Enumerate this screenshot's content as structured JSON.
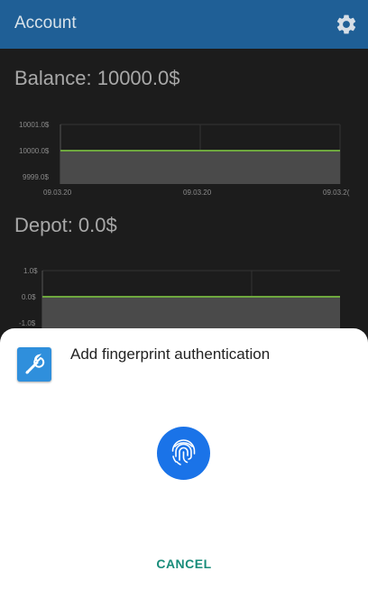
{
  "app_bar": {
    "title": "Account",
    "settings_icon": "gear-icon"
  },
  "balance": {
    "title": "Balance: 10000.0$",
    "chart_data": {
      "type": "area",
      "y_ticks": [
        "10001.0$",
        "10000.0$",
        "9999.0$"
      ],
      "x_ticks": [
        "09.03.20",
        "09.03.20",
        "09.03.2("
      ],
      "ylim": [
        9999.0,
        10001.0
      ],
      "series": [
        {
          "values": [
            10000.0,
            10000.0
          ]
        }
      ],
      "line_color": "#6ea83e",
      "fill_color": "#4a4a4a",
      "grid": true
    }
  },
  "depot": {
    "title": "Depot: 0.0$",
    "chart_data": {
      "type": "area",
      "y_ticks": [
        "1.0$",
        "0.0$",
        "-1.0$"
      ],
      "ylim": [
        -1.0,
        1.0
      ],
      "series": [
        {
          "values": [
            0.0,
            0.0
          ]
        }
      ],
      "line_color": "#6ea83e",
      "fill_color": "#4a4a4a",
      "grid": true
    }
  },
  "sheet": {
    "app_icon": "wrench-icon",
    "title": "Add fingerprint authentication",
    "fingerprint_icon": "fingerprint-icon",
    "cancel_label": "CANCEL",
    "accent_color": "#1a73e8",
    "cancel_color": "#188c7a"
  }
}
